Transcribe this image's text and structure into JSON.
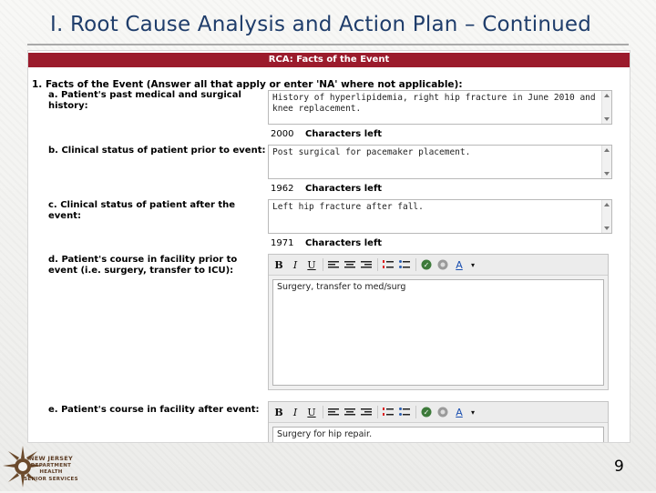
{
  "slide": {
    "title": "I.  Root Cause Analysis and Action Plan – Continued",
    "page_number": "9"
  },
  "form": {
    "header_bar": "RCA: Facts of the Event",
    "section_heading": "1. Facts of the Event (Answer all that apply or enter 'NA' where not applicable):",
    "questions": [
      {
        "label": "a. Patient's past medical and surgical history:",
        "value": "History of hyperlipidemia, right hip fracture in June 2010 and knee replacement.",
        "chars_left": "2000",
        "chars_left_label": "Characters left"
      },
      {
        "label": "b. Clinical status of patient prior to event:",
        "value": "Post surgical for pacemaker placement.",
        "chars_left": "1962",
        "chars_left_label": "Characters left"
      },
      {
        "label": "c. Clinical status of patient after the event:",
        "value": "Left hip fracture after fall.",
        "chars_left": "1971",
        "chars_left_label": "Characters left"
      },
      {
        "label": "d. Patient's course in facility prior to event (i.e. surgery, transfer to ICU):",
        "value": "Surgery, transfer to med/surg"
      },
      {
        "label": "e. Patient's course in facility after event:",
        "value": "Surgery for hip repair."
      }
    ],
    "toolbar": {
      "bold": "B",
      "italic": "I",
      "underline": "U",
      "font_color_label": "A",
      "dropdown_arrow": "▾"
    }
  },
  "logo": {
    "line1": "NEW JERSEY",
    "line2": "DEPARTMENT",
    "line3": "HEALTH",
    "line4": "SENIOR SERVICES"
  },
  "colors": {
    "header_bar": "#9b1b2c",
    "title": "#1f3d6b",
    "logo": "#5a3a22"
  }
}
